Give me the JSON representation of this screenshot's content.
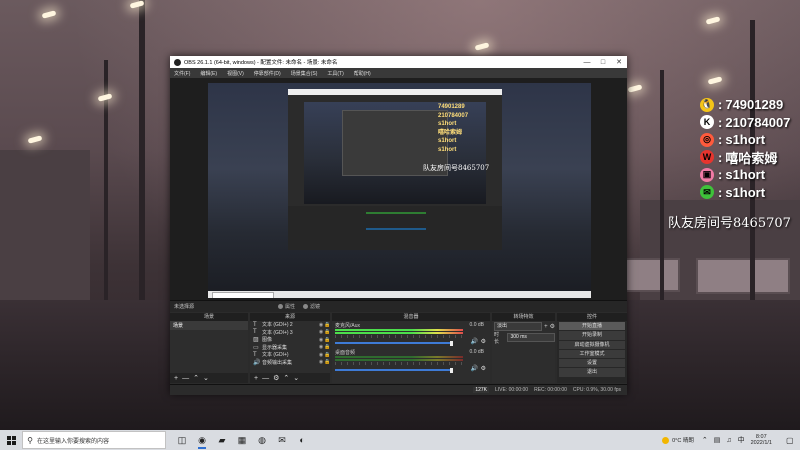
{
  "overlay": {
    "rows": [
      {
        "icon": "qq-icon",
        "color": "#f5c518",
        "text": "74901289"
      },
      {
        "icon": "kuaishou-icon",
        "color": "#ffffff",
        "text": "210784007"
      },
      {
        "icon": "douyu-icon",
        "color": "#ff5a3c",
        "text": "s1hort"
      },
      {
        "icon": "weibo-icon",
        "color": "#e6352e",
        "text": "嘻哈索姆"
      },
      {
        "icon": "bilibili-icon",
        "color": "#f07aa5",
        "text": "s1hort"
      },
      {
        "icon": "wechat-icon",
        "color": "#3fc23a",
        "text": "s1hort"
      }
    ],
    "room": "队友房间号8465707"
  },
  "obs": {
    "title": "OBS 26.1.1 (64-bit, windows) - 配置文件: 未命名 - 场景: 未命名",
    "menu": [
      "文件(F)",
      "编辑(E)",
      "视图(V)",
      "停靠部件(D)",
      "场景集合(S)",
      "工具(T)",
      "帮助(H)"
    ],
    "preview_overlay": [
      "74901289",
      "210784007",
      "s1hort",
      "嘻哈索姆",
      "s1hort",
      "s1hort"
    ],
    "preview_room": "队友房间号8465707",
    "scenebar": {
      "label": "未选择源",
      "properties": "属性",
      "filters": "滤镜"
    },
    "docks": {
      "scenes_title": "场景",
      "sources_title": "来源",
      "mixer_title": "混音器",
      "transitions_title": "转场特效",
      "controls_title": "控件"
    },
    "scenes": [
      "场景"
    ],
    "sources": [
      {
        "icon": "text-icon",
        "name": "文本 (GDI+) 2"
      },
      {
        "icon": "text-icon",
        "name": "文本 (GDI+) 3"
      },
      {
        "icon": "image-icon",
        "name": "图像"
      },
      {
        "icon": "display-capture-icon",
        "name": "显示器采集"
      },
      {
        "icon": "text-icon",
        "name": "文本 (GDI+)"
      },
      {
        "icon": "audio-capture-icon",
        "name": "音频输出采集"
      }
    ],
    "mixer": [
      {
        "name": "麦克风/Aux",
        "db": "0.0 dB",
        "level": 0.0,
        "active": true
      },
      {
        "name": "桌面音频",
        "db": "0.0 dB",
        "level": 0.0,
        "active": false
      }
    ],
    "transitions": {
      "type": "淡出",
      "duration_label": "时长",
      "duration": "300 ms"
    },
    "controls": [
      "开始直播",
      "开始录制",
      "启动虚拟摄像机",
      "工作室模式",
      "设置",
      "退出"
    ],
    "status": {
      "live": "LIVE: 00:00:00",
      "rec": "REC: 00:00:00",
      "cpu": "CPU: 0.9%, 30.00 fps",
      "dropped": "127K"
    }
  },
  "taskbar": {
    "search_placeholder": "在这里输入你要搜索的内容",
    "icons": [
      "task-view-icon",
      "obs-icon",
      "file-explorer-icon",
      "store-icon",
      "chrome-icon",
      "mail-icon",
      "edge-icon"
    ],
    "weather": "0°C 晴朗",
    "time": "8:07",
    "date": "2022/1/1",
    "ime": "中"
  }
}
